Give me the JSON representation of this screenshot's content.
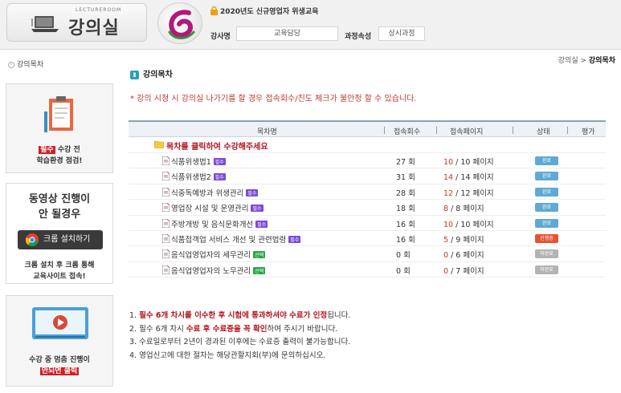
{
  "header": {
    "logo_sub": "LECTUREROOM",
    "logo_title": "강의실",
    "course_title": "2020년도 신규영업자 위생교육",
    "instructor_label": "강사명",
    "instructor_value": "교육담당",
    "attribute_label": "과정속성",
    "attribute_value": "상시과정"
  },
  "sidebar": {
    "nav_label": "강의목차",
    "card1": {
      "tag": "필수",
      "line1_rest": " 수강 전",
      "line2": "학습환경 점검!"
    },
    "card2": {
      "line1": "동영상 진행이",
      "line2": "안 될경우",
      "button": "크롬 설치하기",
      "line3": "크롬 설치 후 크롬 통해",
      "line4": "교육사이트 접속!"
    },
    "card3": {
      "line1": "수강 중 멈춤 진행이",
      "tag": "안되면 클릭"
    }
  },
  "main": {
    "breadcrumb_root": "강의실",
    "breadcrumb_sep": " > ",
    "breadcrumb_current": "강의목차",
    "section_title": "강의목차",
    "notice": "* 강의 시청 시 강의실 나가기를 할 경우 접속회수/진도 체크가 불안정 할 수 있습니다.",
    "table": {
      "headers": {
        "name": "목차명",
        "visits": "접속회수",
        "pages": "접속페이지",
        "status": "상태",
        "eval": "평가"
      },
      "folder_label": "목차를 클릭하여 수강해주세요",
      "rows": [
        {
          "name": "식품위생법1",
          "badge": "필수",
          "visits": "27 회",
          "done": "10",
          "total": "/ 10 페이지",
          "status": "완료"
        },
        {
          "name": "식품위생법2",
          "badge": "필수",
          "visits": "31 회",
          "done": "14",
          "total": "/ 14 페이지",
          "status": "완료"
        },
        {
          "name": "식중독예방과 위생관리",
          "badge": "필수",
          "visits": "28 회",
          "done": "12",
          "total": "/ 12 페이지",
          "status": "완료"
        },
        {
          "name": "영업장 시설 및 운영관리",
          "badge": "필수",
          "visits": "18 회",
          "done": "8",
          "total": "/ 8 페이지",
          "status": "완료"
        },
        {
          "name": "주방개방 및 음식문화개선",
          "badge": "필수",
          "visits": "16 회",
          "done": "10",
          "total": "/ 10 페이지",
          "status": "완료"
        },
        {
          "name": "식품접객업 서비스 개선 및 관련법령",
          "badge": "필수",
          "visits": "16 회",
          "done": "5",
          "total": "/ 9 페이지",
          "status": "진행중"
        },
        {
          "name": "음식업영업자의 세무관리",
          "badge": "선택",
          "visits": "0 회",
          "done": "0",
          "total": "/ 6 페이지",
          "status": "미완료"
        },
        {
          "name": "음식업영업자의 노무관리",
          "badge": "선택",
          "visits": "0 회",
          "done": "0",
          "total": "/ 7 페이지",
          "status": "미완료"
        }
      ]
    },
    "notes": {
      "n1_pre": "1. ",
      "n1_red": "필수 6개 차시를 이수한 후 시험에 통과하셔야 수료가 인정",
      "n1_post": "됩니다.",
      "n2_pre": "2. 필수 6개 차시 ",
      "n2_red": "수료 후 수료증을 꼭 확인",
      "n2_post": "하여 주시기 바랍니다.",
      "n3": "3. 수료일로부터 2년이 경과된 이후에는 수료증 출력이 불가능합니다.",
      "n4": "4. 영업신고에 대한 절차는 해당관할지회(부)에 문의하십시오."
    }
  },
  "colors": {
    "accent_red": "#b5121b",
    "status_done": "#5ea9d6",
    "status_progress": "#e8522e",
    "status_none": "#b3b3b3",
    "required_badge": "#7a4bd6",
    "optional_badge": "#28a745"
  }
}
